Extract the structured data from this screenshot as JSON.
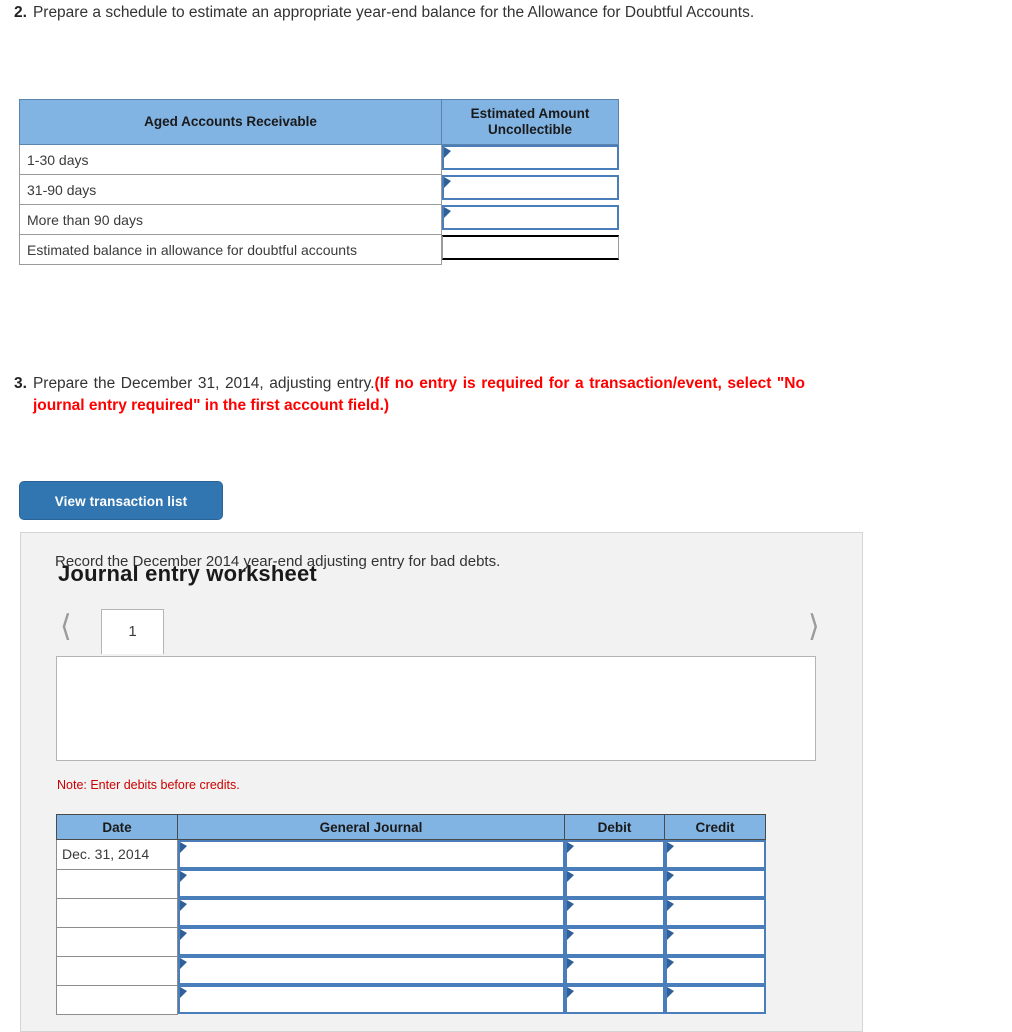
{
  "question2": {
    "number": "2.",
    "text": "Prepare a schedule to estimate an appropriate year-end balance for the Allowance for Doubtful Accounts."
  },
  "question3": {
    "number": "3.",
    "text_plain": "Prepare the December 31, 2014, adjusting entry.",
    "text_red": "(If no entry is required for a transaction/event, select \"No journal entry required\" in the first account field.)"
  },
  "aged_table": {
    "headers": [
      "Aged Accounts Receivable",
      "Estimated Amount Uncollectible"
    ],
    "rows": [
      {
        "label": "1-30 days",
        "amount": "",
        "type": "input"
      },
      {
        "label": "31-90 days",
        "amount": "",
        "type": "input"
      },
      {
        "label": "More than 90 days",
        "amount": "",
        "type": "input"
      },
      {
        "label": "Estimated balance in allowance for doubtful accounts",
        "amount": "",
        "type": "total"
      }
    ]
  },
  "buttons": {
    "view_transaction_list": "View transaction list"
  },
  "worksheet": {
    "title": "Journal entry worksheet",
    "prev_icon": "chevron-left-icon",
    "next_icon": "chevron-right-icon",
    "tabs": [
      {
        "label": "1",
        "active": true
      }
    ],
    "record_text": "Record the December 2014 year-end adjusting entry for bad debts.",
    "note": "Note: Enter debits before credits."
  },
  "journal_table": {
    "headers": [
      "Date",
      "General Journal",
      "Debit",
      "Credit"
    ],
    "rows": [
      {
        "date": "Dec. 31, 2014",
        "general_journal": "",
        "debit": "",
        "credit": ""
      },
      {
        "date": "",
        "general_journal": "",
        "debit": "",
        "credit": ""
      },
      {
        "date": "",
        "general_journal": "",
        "debit": "",
        "credit": ""
      },
      {
        "date": "",
        "general_journal": "",
        "debit": "",
        "credit": ""
      },
      {
        "date": "",
        "general_journal": "",
        "debit": "",
        "credit": ""
      },
      {
        "date": "",
        "general_journal": "",
        "debit": "",
        "credit": ""
      }
    ]
  },
  "colors": {
    "header_blue": "#81b3e3",
    "input_border_blue": "#4a7ebb",
    "button_blue": "#3276b1",
    "alert_red": "#ff0000",
    "note_red": "#cc0000",
    "panel_gray": "#f2f2f2"
  }
}
